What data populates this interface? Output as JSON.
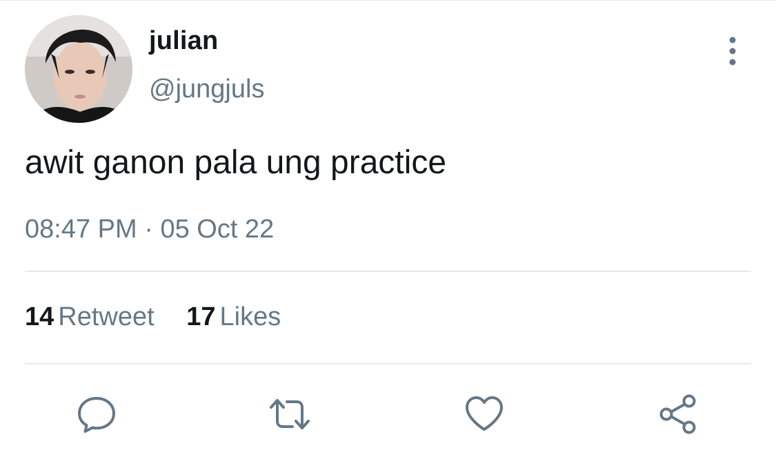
{
  "tweet": {
    "author": {
      "display_name": "julian",
      "handle": "@jungjuls",
      "avatar": "avatar-photo"
    },
    "text": "awit ganon pala ung practice",
    "time": "08:47 PM",
    "separator": "·",
    "date": "05 Oct 22",
    "stats": {
      "retweet_count": "14",
      "retweet_label": "Retweet",
      "like_count": "17",
      "like_label": "Likes"
    },
    "actions": [
      {
        "icon": "reply-icon"
      },
      {
        "icon": "retweet-icon"
      },
      {
        "icon": "heart-icon"
      },
      {
        "icon": "share-icon"
      }
    ],
    "menu_icon": "more-vertical-icon"
  },
  "colors": {
    "text_primary": "#14171a",
    "text_secondary": "#657786",
    "divider": "#e6e9ec",
    "icon": "#657786"
  }
}
